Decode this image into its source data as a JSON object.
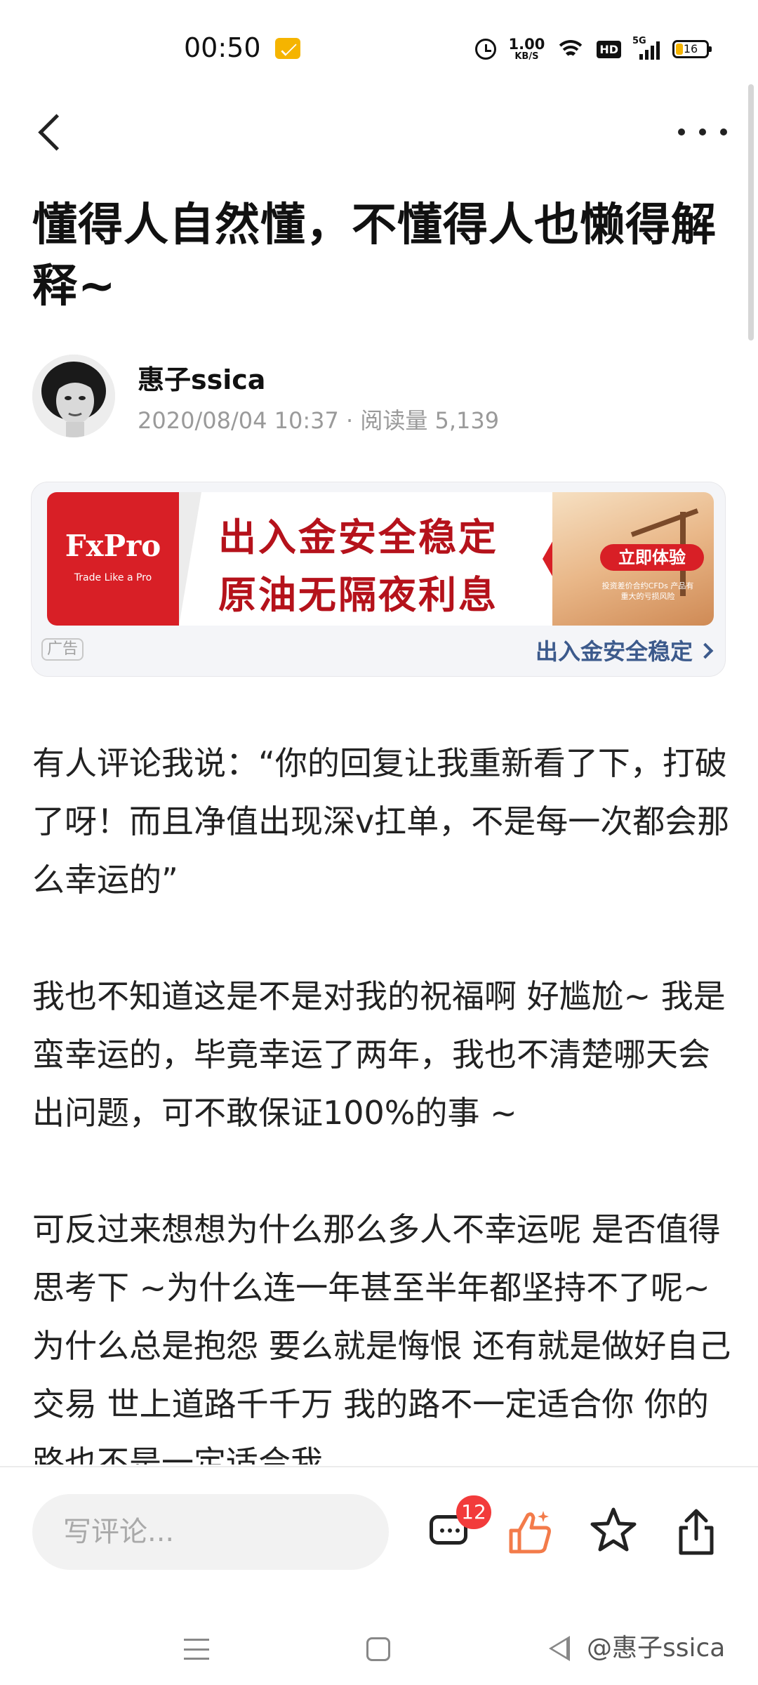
{
  "status_bar": {
    "time": "00:50",
    "net_speed": "1.00",
    "net_unit": "KB/S",
    "hd": "HD",
    "signal": "5G",
    "battery": "16"
  },
  "article": {
    "title": "懂得人自然懂，不懂得人也懒得解释~",
    "author": "惠子ssica",
    "meta": "2020/08/04 10:37 · 阅读量 5,139",
    "paragraphs": [
      "有人评论我说：“你的回复让我重新看了下，打破了呀！而且净值出现深v扛单，不是每一次都会那么幸运的”",
      "我也不知道这是不是对我的祝福啊 好尴尬~ 我是蛮幸运的，毕竟幸运了两年，我也不清楚哪天会出问题，可不敢保证100%的事 ~",
      "可反过来想想为什么那么多人不幸运呢 是否值得思考下 ~为什么连一年甚至半年都坚持不了呢~ 为什么总是抱怨 要么就是悔恨 还有就是做好自己交易 世上道路千千万 我的路不一定适合你 你的路也不是一定适合我"
    ]
  },
  "ad": {
    "brand": "FxPro",
    "tagline": "Trade Like a Pro",
    "line1": "出入金安全稳定",
    "line2": "原油无隔夜利息",
    "cta": "立即体验",
    "fine_print": "投资差价合约CFDs 产品有重大的亏损风险",
    "label": "广告",
    "link_text": "出入金安全稳定"
  },
  "bottom_bar": {
    "comment_placeholder": "写评论...",
    "comment_count": "12"
  },
  "watermark": "@惠子ssica",
  "colors": {
    "accent_red": "#d81f26",
    "like_orange": "#f37b4a",
    "badge_red": "#f23b3b",
    "link_blue": "#3c5a8c"
  },
  "icons": [
    "back-icon",
    "more-icon",
    "comment-icon",
    "like-icon",
    "star-icon",
    "share-icon",
    "menu-icon",
    "home-icon",
    "nav-back-icon"
  ]
}
